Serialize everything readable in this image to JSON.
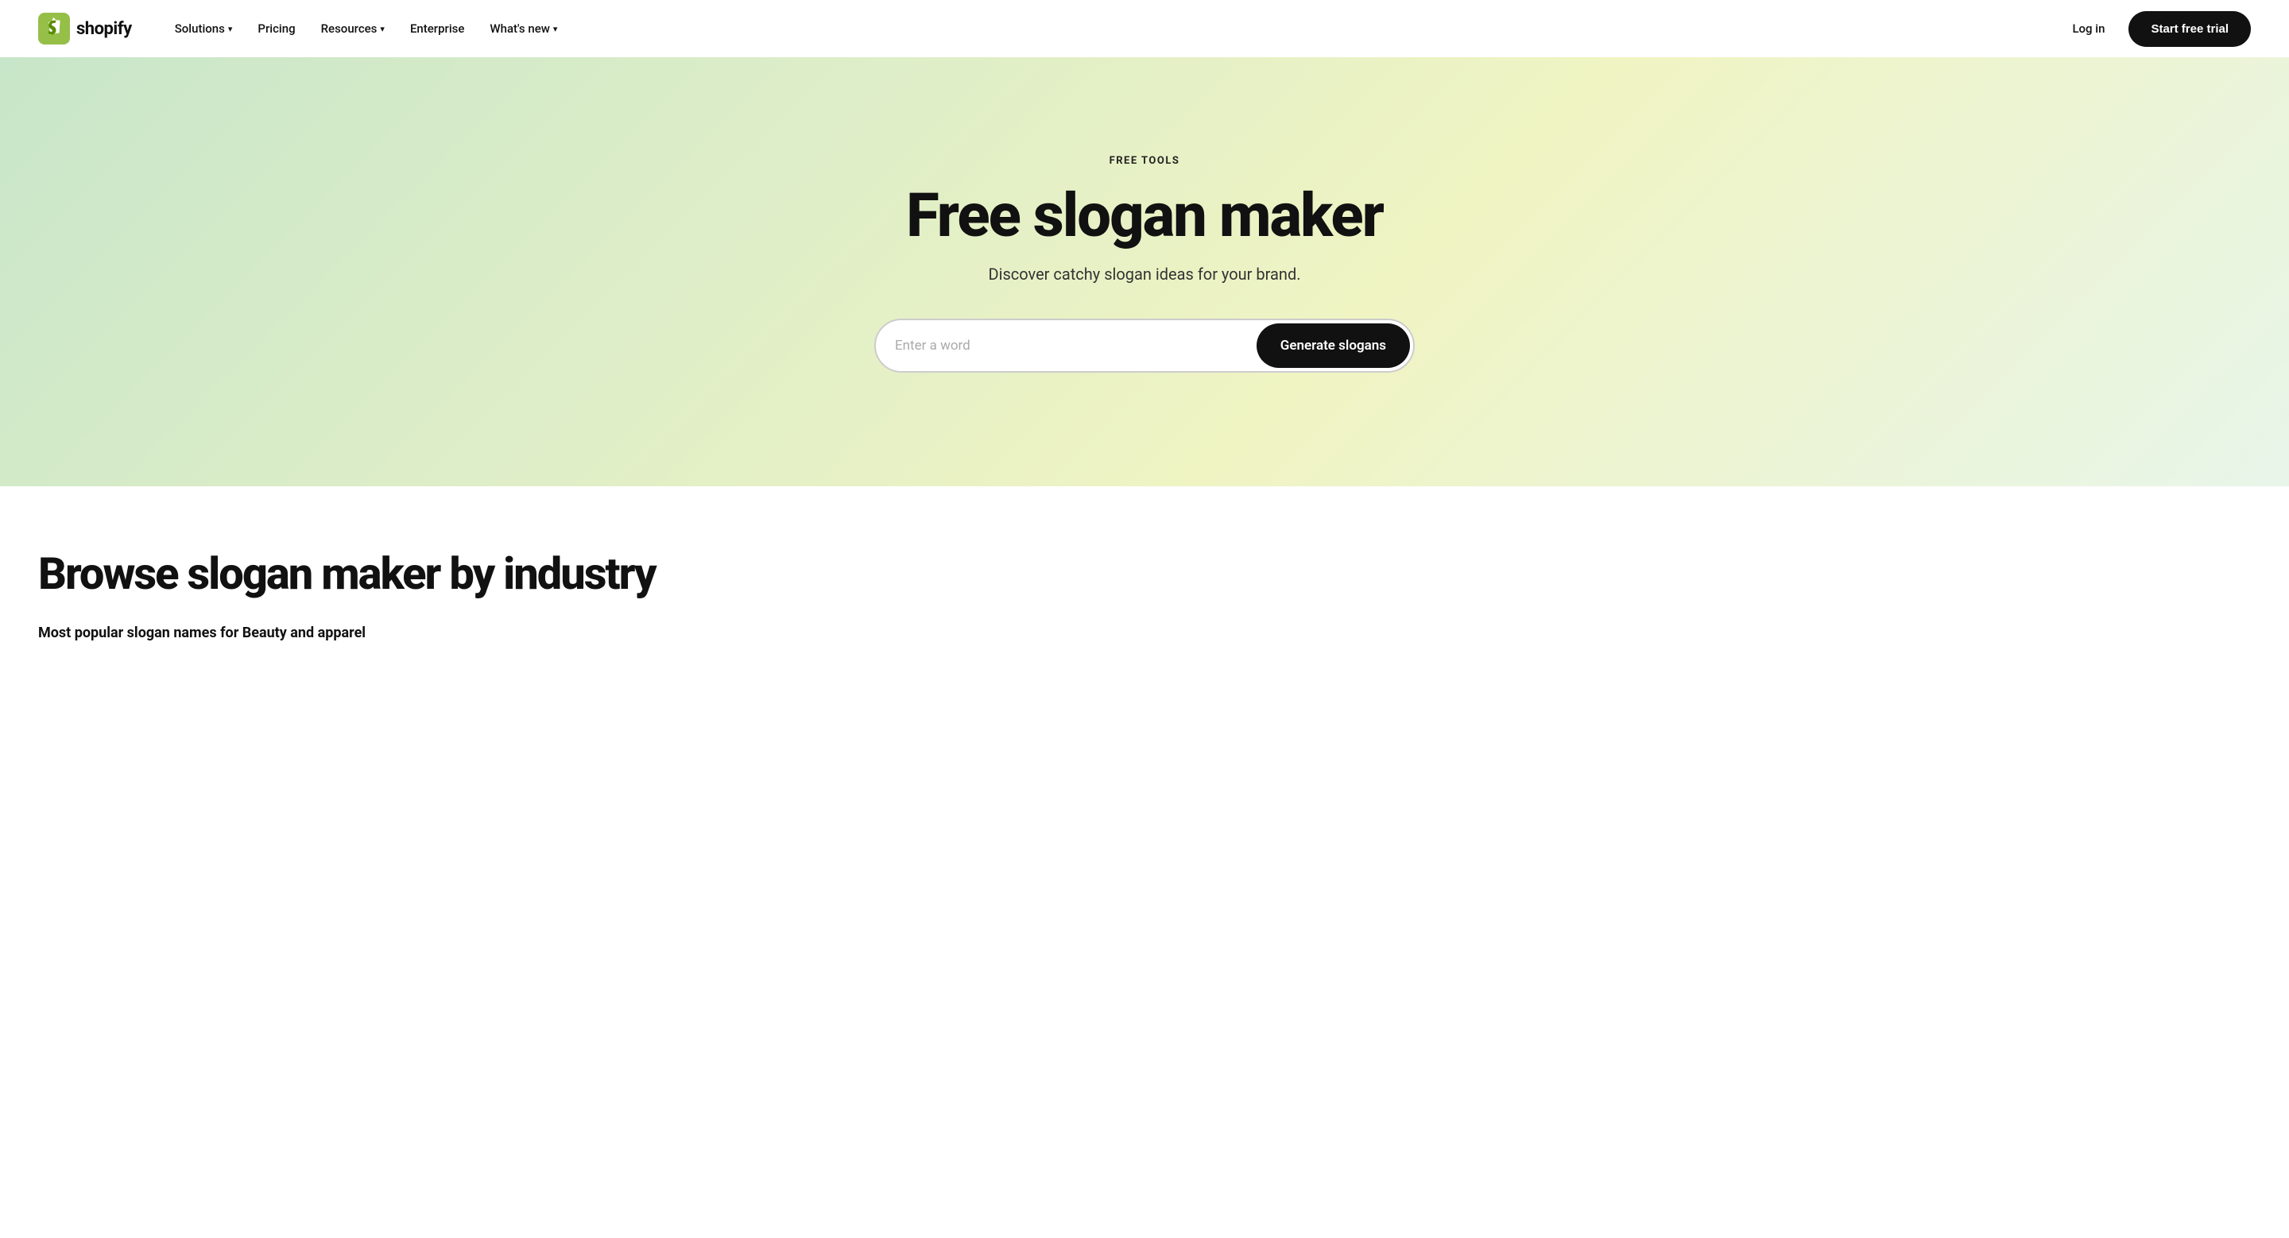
{
  "logo": {
    "text": "shopify",
    "alt": "Shopify"
  },
  "nav": {
    "links": [
      {
        "label": "Solutions",
        "hasDropdown": true
      },
      {
        "label": "Pricing",
        "hasDropdown": false
      },
      {
        "label": "Resources",
        "hasDropdown": true
      },
      {
        "label": "Enterprise",
        "hasDropdown": false
      },
      {
        "label": "What's new",
        "hasDropdown": true
      }
    ],
    "login_label": "Log in",
    "start_trial_label": "Start free trial"
  },
  "hero": {
    "eyebrow": "FREE TOOLS",
    "title": "Free slogan maker",
    "subtitle": "Discover catchy slogan ideas for your brand.",
    "input_placeholder": "Enter a word",
    "generate_button": "Generate slogans"
  },
  "browse": {
    "title": "Browse slogan maker by industry",
    "subtitle": "Most popular slogan names for Beauty and apparel"
  }
}
